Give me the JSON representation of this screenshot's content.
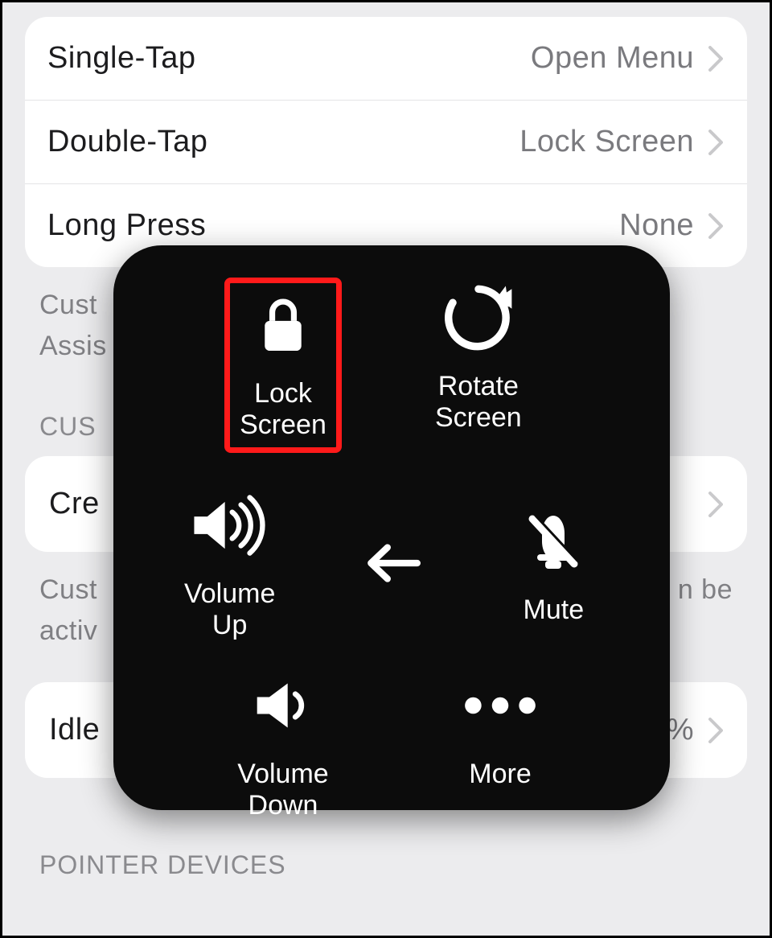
{
  "settings": {
    "rows": [
      {
        "label": "Single-Tap",
        "value": "Open Menu"
      },
      {
        "label": "Double-Tap",
        "value": "Lock Screen"
      },
      {
        "label": "Long Press",
        "value": "None"
      }
    ],
    "desc1_line1": "Cust",
    "desc1_line2": "Assis",
    "section1": "CUS",
    "create_label": "Cre",
    "desc2_line1": "Cust",
    "desc2_line2": "activ",
    "desc2_right": "n be",
    "idle_label": "Idle",
    "idle_value_suffix": "%",
    "section2": "POINTER DEVICES"
  },
  "menu": {
    "lock_screen": "Lock\nScreen",
    "rotate_screen": "Rotate\nScreen",
    "volume_up": "Volume\nUp",
    "mute": "Mute",
    "volume_down": "Volume\nDown",
    "more": "More"
  }
}
